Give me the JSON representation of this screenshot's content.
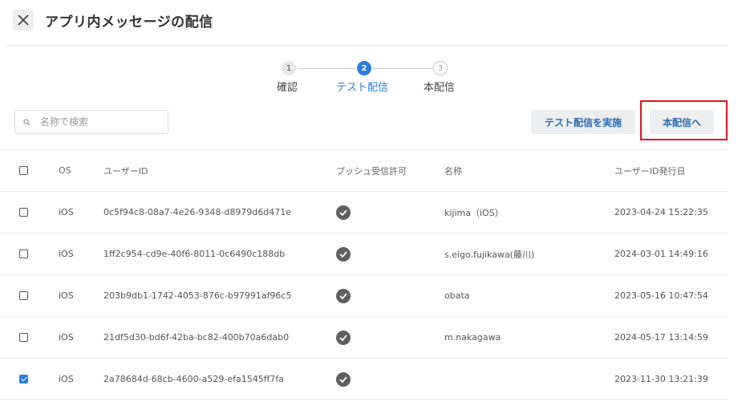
{
  "header": {
    "title": "アプリ内メッセージの配信"
  },
  "stepper": {
    "steps": [
      {
        "number": "1",
        "label": "確認"
      },
      {
        "number": "2",
        "label": "テスト配信"
      },
      {
        "number": "3",
        "label": "本配信"
      }
    ],
    "active_index": 1
  },
  "toolbar": {
    "search_placeholder": "名称で検索",
    "test_send_label": "テスト配信を実施",
    "send_label": "本配信へ"
  },
  "table": {
    "headers": [
      "OS",
      "ユーザーID",
      "プッシュ受信許可",
      "名称",
      "ユーザーID発行日"
    ],
    "rows": [
      {
        "os": "iOS",
        "user_id": "0c5f94c8-08a7-4e26-9348-d8979d6d471e",
        "name": "kijima（iOS）",
        "issued": "2023-04-24 15:22:35",
        "checked": false
      },
      {
        "os": "iOS",
        "user_id": "1ff2c954-cd9e-40f6-8011-0c6490c188db",
        "name": "s.eigo.fujikawa(藤川)",
        "issued": "2024-03-01 14:49:16",
        "checked": false
      },
      {
        "os": "iOS",
        "user_id": "203b9db1-1742-4053-876c-b97991af96c5",
        "name": "obata",
        "issued": "2023-05-16 10:47:54",
        "checked": false
      },
      {
        "os": "iOS",
        "user_id": "21df5d30-bd6f-42ba-bc82-400b70a6dab0",
        "name": "m.nakagawa",
        "issued": "2024-05-17 13:14:59",
        "checked": false
      },
      {
        "os": "iOS",
        "user_id": "2a78684d-68cb-4600-a529-efa1545ff7fa",
        "name": "",
        "issued": "2023-11-30 13:21:39",
        "checked": true
      }
    ]
  },
  "colors": {
    "accent": "#2c7ee0",
    "highlight": "#e0141e",
    "button_bg": "#eceef0"
  },
  "icons": [
    "close-icon",
    "search-icon",
    "check-circle-icon"
  ]
}
